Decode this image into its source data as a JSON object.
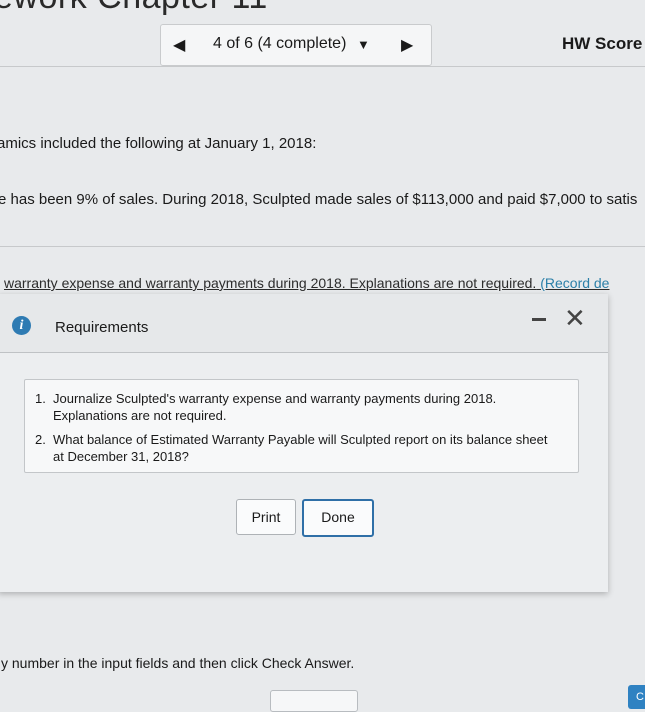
{
  "page": {
    "title_fragment": "ework Chapter 11"
  },
  "nav": {
    "prev_icon": "◀",
    "progress_label": "4 of 6 (4 complete)",
    "dropdown_icon": "▼",
    "next_icon": "▶"
  },
  "header": {
    "hw_score_label": "HW Score"
  },
  "question": {
    "line1": "amics included the following at January 1, 2018:",
    "line2": "e has been 9% of sales. During 2018, Sculpted made sales of $113,000 and paid $7,000 to satis",
    "line3_a": "warranty expense and warranty payments during 2018. Explanations are not required.",
    "line3_b": " (Record de"
  },
  "dialog": {
    "info_icon": "i",
    "title": "Requirements",
    "minimize_icon": "-",
    "close_icon": "✕",
    "requirements": [
      {
        "num": "1.",
        "text": "Journalize Sculpted's warranty expense and warranty payments during 2018. Explanations are not required."
      },
      {
        "num": "2.",
        "text": "What balance of Estimated Warranty Payable will Sculpted report on its balance sheet at December 31, 2018?"
      }
    ],
    "print_label": "Print",
    "done_label": "Done"
  },
  "footer": {
    "instruction": "y number in the input fields and then click Check Answer.",
    "corner_label": "C"
  }
}
